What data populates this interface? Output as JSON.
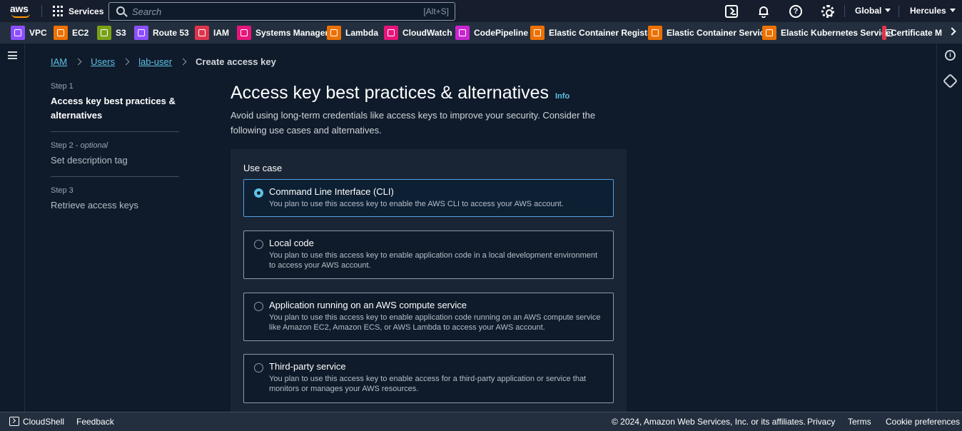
{
  "topnav": {
    "logo_text": "aws",
    "services_label": "Services",
    "search_placeholder": "Search",
    "search_shortcut": "[Alt+S]",
    "region_label": "Global",
    "user_label": "Hercules",
    "icons": [
      "cloudshell-icon",
      "bell-icon",
      "help-icon",
      "gear-icon"
    ],
    "help_glyph": "?"
  },
  "favorites": [
    {
      "label": "VPC",
      "color": "#8c4fff"
    },
    {
      "label": "EC2",
      "color": "#ed7100"
    },
    {
      "label": "S3",
      "color": "#7aa116"
    },
    {
      "label": "Route 53",
      "color": "#8c4fff"
    },
    {
      "label": "IAM",
      "color": "#dd344c"
    },
    {
      "label": "Systems Manager",
      "color": "#e7157b"
    },
    {
      "label": "Lambda",
      "color": "#ed7100"
    },
    {
      "label": "CloudWatch",
      "color": "#e7157b"
    },
    {
      "label": "CodePipeline",
      "color": "#c925d1"
    },
    {
      "label": "Elastic Container Registry",
      "color": "#ed7100"
    },
    {
      "label": "Elastic Container Service",
      "color": "#ed7100"
    },
    {
      "label": "Elastic Kubernetes Service",
      "color": "#ed7100"
    },
    {
      "label": "Certificate M",
      "color": "#dd344c"
    }
  ],
  "breadcrumb": {
    "items": [
      "IAM",
      "Users",
      "lab-user"
    ],
    "current": "Create access key"
  },
  "steps": [
    {
      "number": "Step 1",
      "optional": "",
      "title": "Access key best practices & alternatives"
    },
    {
      "number": "Step 2",
      "optional": "optional",
      "title": "Set description tag"
    },
    {
      "number": "Step 3",
      "optional": "",
      "title": "Retrieve access keys"
    }
  ],
  "main": {
    "title": "Access key best practices & alternatives",
    "info_link": "Info",
    "description": "Avoid using long-term credentials like access keys to improve your security. Consider the following use cases and alternatives.",
    "use_case_label": "Use case",
    "options": [
      {
        "title": "Command Line Interface (CLI)",
        "description": "You plan to use this access key to enable the AWS CLI to access your AWS account.",
        "selected": true
      },
      {
        "title": "Local code",
        "description": "You plan to use this access key to enable application code in a local development environment to access your AWS account.",
        "selected": false
      },
      {
        "title": "Application running on an AWS compute service",
        "description": "You plan to use this access key to enable application code running on an AWS compute service like Amazon EC2, Amazon ECS, or AWS Lambda to access your AWS account.",
        "selected": false
      },
      {
        "title": "Third-party service",
        "description": "You plan to use this access key to enable access for a third-party application or service that monitors or manages your AWS resources.",
        "selected": false
      }
    ]
  },
  "footer": {
    "cloudshell": "CloudShell",
    "feedback": "Feedback",
    "copyright": "© 2024, Amazon Web Services, Inc. or its affiliates.",
    "privacy": "Privacy",
    "terms": "Terms",
    "cookies": "Cookie preferences"
  },
  "rightrail": {
    "info_glyph": "i"
  }
}
